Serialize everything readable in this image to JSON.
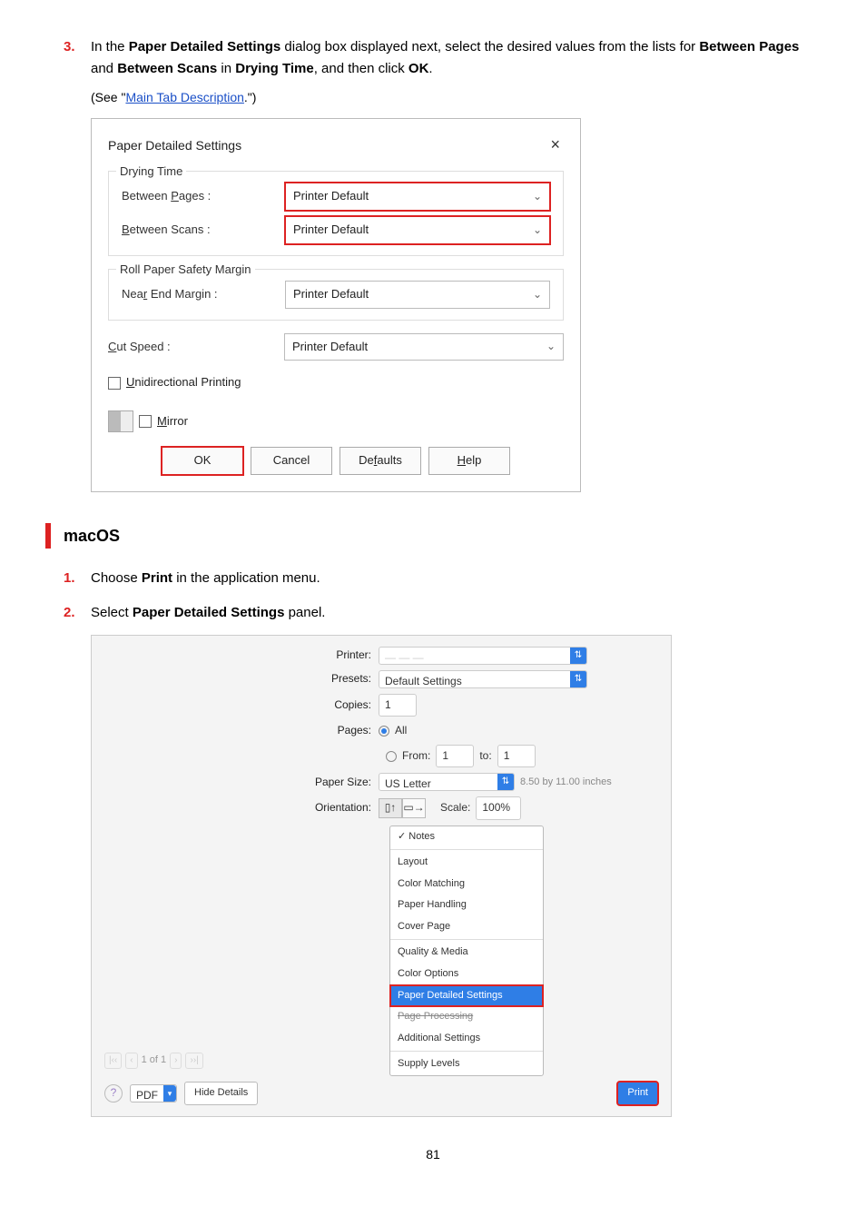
{
  "step3": {
    "num": "3.",
    "t1": "In the ",
    "b1": "Paper Detailed Settings",
    "t2": " dialog box displayed next, select the desired values from the lists for ",
    "b2": "Between Pages",
    "t3": " and ",
    "b3": "Between Scans",
    "t4": " in ",
    "b4": "Drying Time",
    "t5": ", and then click ",
    "b5": "OK",
    "t6": "."
  },
  "see": {
    "pre": "(See \"",
    "link": "Main Tab Description",
    "post": ".\")"
  },
  "winDialog": {
    "title": "Paper Detailed Settings",
    "close": "×",
    "dryingTime": {
      "legend": "Drying Time",
      "betweenPagesLbl": {
        "pre": "Between ",
        "u": "P",
        "post": "ages :"
      },
      "betweenPagesVal": "Printer Default",
      "betweenScansLbl": {
        "u": "B",
        "post": "etween Scans :"
      },
      "betweenScansVal": "Printer Default"
    },
    "safetyMargin": {
      "legend": "Roll Paper Safety Margin",
      "nearEndLbl": {
        "pre": "Nea",
        "u": "r",
        "post": " End Margin :"
      },
      "val": "Printer Default"
    },
    "cutSpeed": {
      "lbl": {
        "u": "C",
        "post": "ut Speed :"
      },
      "val": "Printer Default"
    },
    "uni": {
      "u": "U",
      "post": "nidirectional Printing"
    },
    "mirror": {
      "u": "M",
      "post": "irror"
    },
    "buttons": {
      "ok": "OK",
      "cancel": "Cancel",
      "defaults": {
        "pre": "De",
        "u": "f",
        "post": "aults"
      },
      "help": {
        "u": "H",
        "post": "elp"
      }
    }
  },
  "macHeading": "macOS",
  "step1m": {
    "num": "1.",
    "t1": "Choose ",
    "b1": "Print",
    "t2": " in the application menu."
  },
  "step2m": {
    "num": "2.",
    "t1": "Select ",
    "b1": "Paper Detailed Settings",
    "t2": " panel."
  },
  "macDialog": {
    "labels": {
      "printer": "Printer:",
      "presets": "Presets:",
      "copies": "Copies:",
      "pages": "Pages:",
      "all": "All",
      "from": "From:",
      "to": "to:",
      "paperSize": "Paper Size:",
      "orientation": "Orientation:",
      "scale": "Scale:"
    },
    "values": {
      "presets": "Default Settings",
      "copies": "1",
      "from": "1",
      "to": "1",
      "paperSize": "US Letter",
      "paperDim": "8.50 by 11.00 inches",
      "scale": "100%"
    },
    "panelOptions": {
      "notes": "Notes",
      "layout": "Layout",
      "colorMatching": "Color Matching",
      "paperHandling": "Paper Handling",
      "coverPage": "Cover Page",
      "qualityMedia": "Quality & Media",
      "colorOptions": "Color Options",
      "paperDetailed": "Paper Detailed Settings",
      "pageProcessing": "Page Processing",
      "additional": "Additional Settings",
      "supply": "Supply Levels"
    },
    "preview": {
      "pageNav": "1 of 1"
    },
    "bottom": {
      "pdf": "PDF",
      "hide": "Hide Details",
      "print": "Print"
    }
  },
  "pageNumber": "81"
}
